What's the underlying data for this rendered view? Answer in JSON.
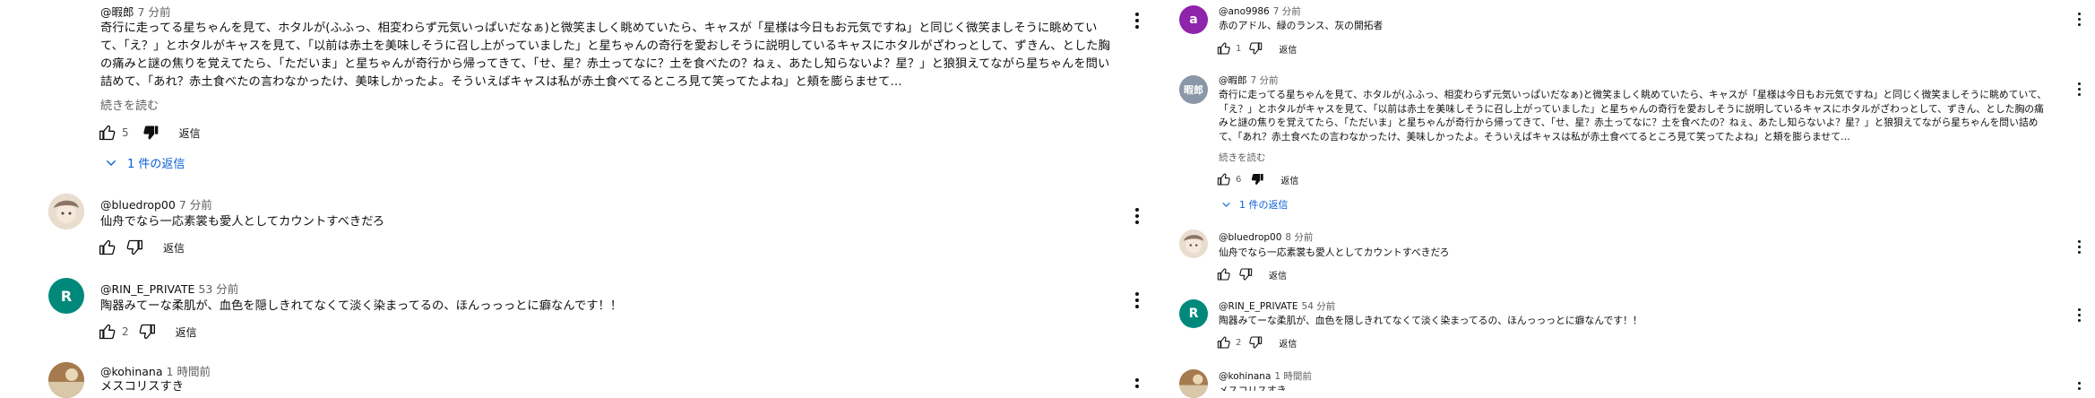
{
  "left": {
    "comments": [
      {
        "avatar_text": "暇郎",
        "avatar_color": "#8a97a8",
        "author": "@暇郎",
        "time": "7 分前",
        "text": "奇行に走ってる星ちゃんを見て、ホタルが(ふふっ、相変わらず元気いっぱいだなぁ)と微笑ましく眺めていたら、キャスが「星様は今日もお元気ですね」と同じく微笑ましそうに眺めていて、「え？」とホタルがキャスを見て、「以前は赤土を美味しそうに召し上がっていました」と星ちゃんの奇行を愛おしそうに説明しているキャスにホタルがざわっとして、ずきん、とした胸の痛みと謎の焦りを覚えてたら、「ただいま」と星ちゃんが奇行から帰ってきて、「せ、星？赤土ってなに？土を食べたの？ねぇ、あたし知らないよ？星？」と狼狽えてながら星ちゃんを問い詰めて、「あれ？赤土食べたの言わなかったけ、美味しかったよ。そういえばキャスは私が赤土食べてるところ見て笑ってたよね」と頬を膨らませて…",
        "read_more": "続きを読む",
        "likes": "5",
        "reply": "返信",
        "replies": "1 件の返信"
      },
      {
        "avatar_color": "#c9b9a3",
        "author": "@bluedrop00",
        "time": "7 分前",
        "text": "仙舟でなら一応素裳も愛人としてカウントすべきだろ",
        "likes": "",
        "reply": "返信"
      },
      {
        "avatar_text": "R",
        "avatar_color": "#00897b",
        "author": "@RIN_E_PRIVATE",
        "time": "53 分前",
        "text": "陶器みてーな柔肌が、血色を隠しきれてなくて淡く染まってるの、ほんっっっとに癖なんです！！",
        "likes": "2",
        "reply": "返信"
      },
      {
        "avatar_color": "#b08a5c",
        "author": "@kohinana",
        "time": "1 時間前",
        "text": "メスコリスすき"
      }
    ]
  },
  "right": {
    "comments": [
      {
        "avatar_text": "a",
        "avatar_color": "#8e24aa",
        "author": "@ano9986",
        "time": "7 分前",
        "text": "赤のアドル、緑のランス、灰の開拓者",
        "likes": "1",
        "reply": "返信"
      },
      {
        "avatar_text": "暇郎",
        "avatar_color": "#8a97a8",
        "author": "@暇郎",
        "time": "7 分前",
        "text": "奇行に走ってる星ちゃんを見て、ホタルが(ふふっ、相変わらず元気いっぱいだなぁ)と微笑ましく眺めていたら、キャスが「星様は今日もお元気ですね」と同じく微笑ましそうに眺めていて、「え？」とホタルがキャスを見て、「以前は赤土を美味しそうに召し上がっていました」と星ちゃんの奇行を愛おしそうに説明しているキャスにホタルがざわっとして、ずきん、とした胸の痛みと謎の焦りを覚えてたら、「ただいま」と星ちゃんが奇行から帰ってきて、「せ、星？赤土ってなに？土を食べたの？ねぇ、あたし知らないよ？星？」と狼狽えてながら星ちゃんを問い詰めて、「あれ？赤土食べたの言わなかったけ、美味しかったよ。そういえばキャスは私が赤土食べてるところ見て笑ってたよね」と頬を膨らませて…",
        "read_more": "続きを読む",
        "likes": "6",
        "reply": "返信",
        "replies": "1 件の返信"
      },
      {
        "avatar_color": "#c9b9a3",
        "author": "@bluedrop00",
        "time": "8 分前",
        "text": "仙舟でなら一応素裳も愛人としてカウントすべきだろ",
        "likes": "",
        "reply": "返信"
      },
      {
        "avatar_text": "R",
        "avatar_color": "#00897b",
        "author": "@RIN_E_PRIVATE",
        "time": "54 分前",
        "text": "陶器みてーな柔肌が、血色を隠しきれてなくて淡く染まってるの、ほんっっっとに癖なんです！！",
        "likes": "2",
        "reply": "返信"
      },
      {
        "avatar_color": "#b08a5c",
        "author": "@kohinana",
        "time": "1 時間前",
        "text": "メスコリスすき"
      }
    ]
  }
}
